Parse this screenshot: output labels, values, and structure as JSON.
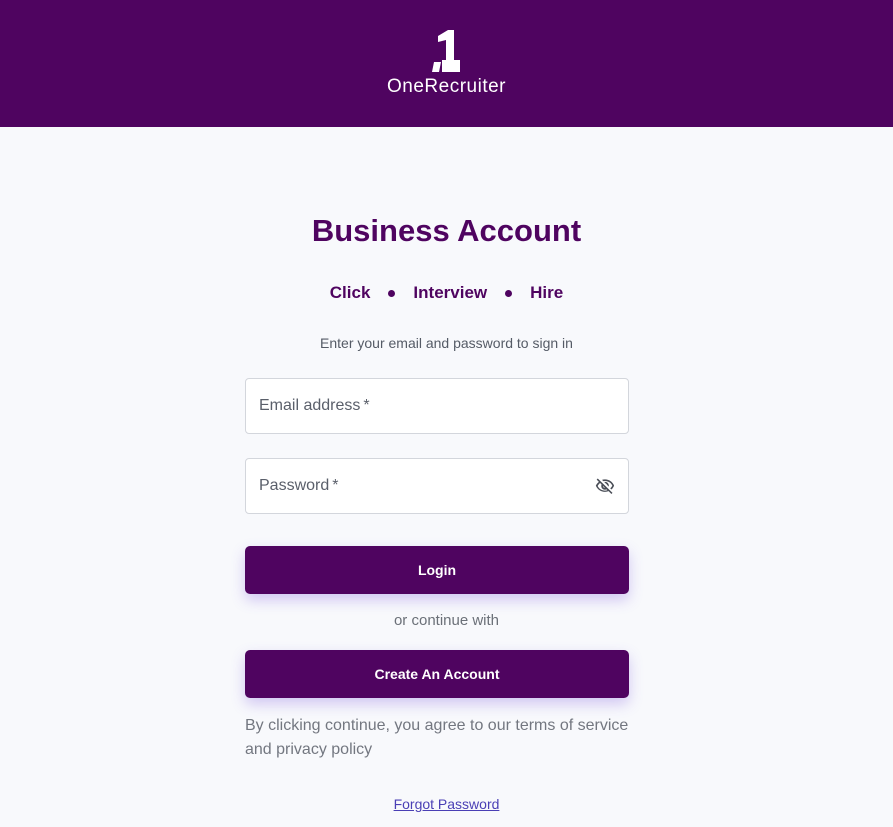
{
  "header": {
    "logo_text": "OneRecruiter",
    "logo_mark": "1",
    "background_color": "#4f0460"
  },
  "title": "Business Account",
  "tagline": [
    "Click",
    "Interview",
    "Hire"
  ],
  "subtitle": "Enter your email and password to sign in",
  "form": {
    "email_label": "Email address",
    "password_label": "Password",
    "required_marker": "*",
    "password_toggle_icon": "eye-off-icon"
  },
  "buttons": {
    "login": "Login",
    "create_account": "Create An Account"
  },
  "or_text": "or continue with",
  "terms_text": "By clicking continue, you agree to our terms of service and privacy policy",
  "forgot_password": "Forgot Password",
  "colors": {
    "primary": "#4f0460",
    "link": "#4a3fb5",
    "page_background": "#f8f9fc"
  }
}
